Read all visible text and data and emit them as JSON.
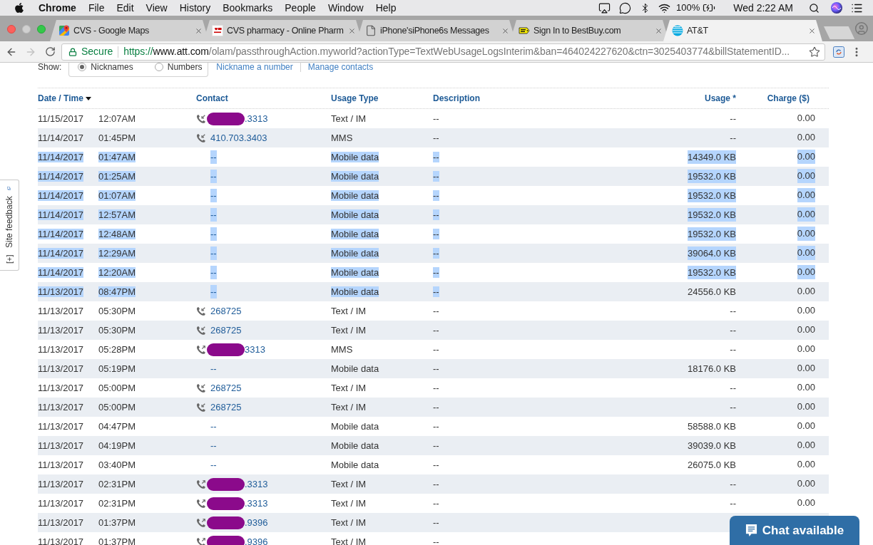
{
  "menu_bar": {
    "app_name": "Chrome",
    "menus": [
      "File",
      "Edit",
      "View",
      "History",
      "Bookmarks",
      "People",
      "Window",
      "Help"
    ],
    "battery": "100%",
    "clock": "Wed 2:22 AM"
  },
  "tabs": [
    {
      "kind": "maps",
      "title": "CVS - Google Maps",
      "selected": false
    },
    {
      "kind": "pharmacy",
      "title": "CVS pharmacy - Online Pharm",
      "selected": false
    },
    {
      "kind": "document",
      "title": "iPhone'siPhone6s Messages",
      "selected": false
    },
    {
      "kind": "store",
      "title": "Sign In to BestBuy.com",
      "selected": false
    },
    {
      "kind": "globe",
      "title": "AT&T",
      "selected": true
    }
  ],
  "toolbar": {
    "back": {
      "disabled": false
    },
    "forward": {
      "disabled": true
    },
    "secure_label": "Secure",
    "url": {
      "scheme": "https://",
      "host": "www.att.com",
      "path": "/olam/passthroughAction.myworld?actionType=TextWebUsageLogsInterim&ban=464024227620&ctn=3025403774&billStatementID..."
    }
  },
  "show_options": {
    "label": "Show:",
    "options": [
      {
        "label": "Nicknames",
        "selected": true
      },
      {
        "label": "Numbers",
        "selected": false
      }
    ],
    "links": [
      "Nickname a number",
      "Manage contacts"
    ]
  },
  "table": {
    "columns": [
      {
        "label": "Date / Time",
        "sorted": true
      },
      {
        "label": "Contact",
        "sorted": false
      },
      {
        "label": "Usage Type",
        "sorted": false
      },
      {
        "label": "Description",
        "sorted": false
      },
      {
        "label": "Usage *",
        "sorted": false
      },
      {
        "label": "Charge ($)",
        "sorted": false
      }
    ],
    "rows": [
      {
        "date": "11/15/2017",
        "time": "12:07AM",
        "contact": {
          "kind": "incoming",
          "redacted": true,
          "number": ".3313"
        },
        "usage_type": "Text / IM",
        "description": "--",
        "usage": "--",
        "charge": "0.00",
        "selected": false,
        "usage_selected": false
      },
      {
        "date": "11/14/2017",
        "time": "01:45PM",
        "contact": {
          "kind": "incoming",
          "redacted": false,
          "number": "410.703.3403"
        },
        "usage_type": "MMS",
        "description": "--",
        "usage": "--",
        "charge": "0.00",
        "selected": false,
        "usage_selected": false
      },
      {
        "date": "11/14/2017",
        "time": "01:47AM",
        "contact": {
          "kind": "none",
          "redacted": false,
          "number": "--"
        },
        "usage_type": "Mobile data",
        "description": "--",
        "usage": "14349.0 KB",
        "charge": "0.00",
        "selected": true,
        "usage_selected": true
      },
      {
        "date": "11/14/2017",
        "time": "01:25AM",
        "contact": {
          "kind": "none",
          "redacted": false,
          "number": "--"
        },
        "usage_type": "Mobile data",
        "description": "--",
        "usage": "19532.0 KB",
        "charge": "0.00",
        "selected": true,
        "usage_selected": true
      },
      {
        "date": "11/14/2017",
        "time": "01:07AM",
        "contact": {
          "kind": "none",
          "redacted": false,
          "number": "--"
        },
        "usage_type": "Mobile data",
        "description": "--",
        "usage": "19532.0 KB",
        "charge": "0.00",
        "selected": true,
        "usage_selected": true
      },
      {
        "date": "11/14/2017",
        "time": "12:57AM",
        "contact": {
          "kind": "none",
          "redacted": false,
          "number": "--"
        },
        "usage_type": "Mobile data",
        "description": "--",
        "usage": "19532.0 KB",
        "charge": "0.00",
        "selected": true,
        "usage_selected": true
      },
      {
        "date": "11/14/2017",
        "time": "12:48AM",
        "contact": {
          "kind": "none",
          "redacted": false,
          "number": "--"
        },
        "usage_type": "Mobile data",
        "description": "--",
        "usage": "19532.0 KB",
        "charge": "0.00",
        "selected": true,
        "usage_selected": true
      },
      {
        "date": "11/14/2017",
        "time": "12:29AM",
        "contact": {
          "kind": "none",
          "redacted": false,
          "number": "--"
        },
        "usage_type": "Mobile data",
        "description": "--",
        "usage": "39064.0 KB",
        "charge": "0.00",
        "selected": true,
        "usage_selected": true
      },
      {
        "date": "11/14/2017",
        "time": "12:20AM",
        "contact": {
          "kind": "none",
          "redacted": false,
          "number": "--"
        },
        "usage_type": "Mobile data",
        "description": "--",
        "usage": "19532.0 KB",
        "charge": "0.00",
        "selected": true,
        "usage_selected": true
      },
      {
        "date": "11/13/2017",
        "time": "08:47PM",
        "contact": {
          "kind": "none",
          "redacted": false,
          "number": "--"
        },
        "usage_type": "Mobile data",
        "description": "--",
        "usage": "24556.0 KB",
        "charge": "0.00",
        "selected": true,
        "usage_selected": false
      },
      {
        "date": "11/13/2017",
        "time": "05:30PM",
        "contact": {
          "kind": "incoming",
          "redacted": false,
          "number": "268725"
        },
        "usage_type": "Text / IM",
        "description": "--",
        "usage": "--",
        "charge": "0.00",
        "selected": false,
        "usage_selected": false
      },
      {
        "date": "11/13/2017",
        "time": "05:30PM",
        "contact": {
          "kind": "incoming",
          "redacted": false,
          "number": "268725"
        },
        "usage_type": "Text / IM",
        "description": "--",
        "usage": "--",
        "charge": "0.00",
        "selected": false,
        "usage_selected": false
      },
      {
        "date": "11/13/2017",
        "time": "05:28PM",
        "contact": {
          "kind": "outgoing",
          "redacted": true,
          "number": "3313"
        },
        "usage_type": "MMS",
        "description": "--",
        "usage": "--",
        "charge": "0.00",
        "selected": false,
        "usage_selected": false
      },
      {
        "date": "11/13/2017",
        "time": "05:19PM",
        "contact": {
          "kind": "none",
          "redacted": false,
          "number": "--"
        },
        "usage_type": "Mobile data",
        "description": "--",
        "usage": "18176.0 KB",
        "charge": "0.00",
        "selected": false,
        "usage_selected": false
      },
      {
        "date": "11/13/2017",
        "time": "05:00PM",
        "contact": {
          "kind": "incoming",
          "redacted": false,
          "number": "268725"
        },
        "usage_type": "Text / IM",
        "description": "--",
        "usage": "--",
        "charge": "0.00",
        "selected": false,
        "usage_selected": false
      },
      {
        "date": "11/13/2017",
        "time": "05:00PM",
        "contact": {
          "kind": "incoming",
          "redacted": false,
          "number": "268725"
        },
        "usage_type": "Text / IM",
        "description": "--",
        "usage": "--",
        "charge": "0.00",
        "selected": false,
        "usage_selected": false
      },
      {
        "date": "11/13/2017",
        "time": "04:47PM",
        "contact": {
          "kind": "none",
          "redacted": false,
          "number": "--"
        },
        "usage_type": "Mobile data",
        "description": "--",
        "usage": "58588.0 KB",
        "charge": "0.00",
        "selected": false,
        "usage_selected": false
      },
      {
        "date": "11/13/2017",
        "time": "04:19PM",
        "contact": {
          "kind": "none",
          "redacted": false,
          "number": "--"
        },
        "usage_type": "Mobile data",
        "description": "--",
        "usage": "39039.0 KB",
        "charge": "0.00",
        "selected": false,
        "usage_selected": false
      },
      {
        "date": "11/13/2017",
        "time": "03:40PM",
        "contact": {
          "kind": "none",
          "redacted": false,
          "number": "--"
        },
        "usage_type": "Mobile data",
        "description": "--",
        "usage": "26075.0 KB",
        "charge": "0.00",
        "selected": false,
        "usage_selected": false
      },
      {
        "date": "11/13/2017",
        "time": "02:31PM",
        "contact": {
          "kind": "outgoing",
          "redacted": true,
          "number": ".3313"
        },
        "usage_type": "Text / IM",
        "description": "--",
        "usage": "--",
        "charge": "0.00",
        "selected": false,
        "usage_selected": false
      },
      {
        "date": "11/13/2017",
        "time": "02:31PM",
        "contact": {
          "kind": "outgoing",
          "redacted": true,
          "number": ".3313"
        },
        "usage_type": "Text / IM",
        "description": "--",
        "usage": "--",
        "charge": "0.00",
        "selected": false,
        "usage_selected": false
      },
      {
        "date": "11/13/2017",
        "time": "01:37PM",
        "contact": {
          "kind": "outgoing",
          "redacted": true,
          "number": ".9396"
        },
        "usage_type": "Text / IM",
        "description": "--",
        "selected": false
      },
      {
        "date": "11/13/2017",
        "time": "01:37PM",
        "contact": {
          "kind": "outgoing",
          "redacted": true,
          "number": ".9396"
        },
        "usage_type": "Text / IM",
        "description": "--",
        "selected": false
      }
    ]
  },
  "feedback_tab": {
    "label": "Site feedback",
    "expand_label": "[+]"
  },
  "chat_button": {
    "label": "Chat available"
  }
}
